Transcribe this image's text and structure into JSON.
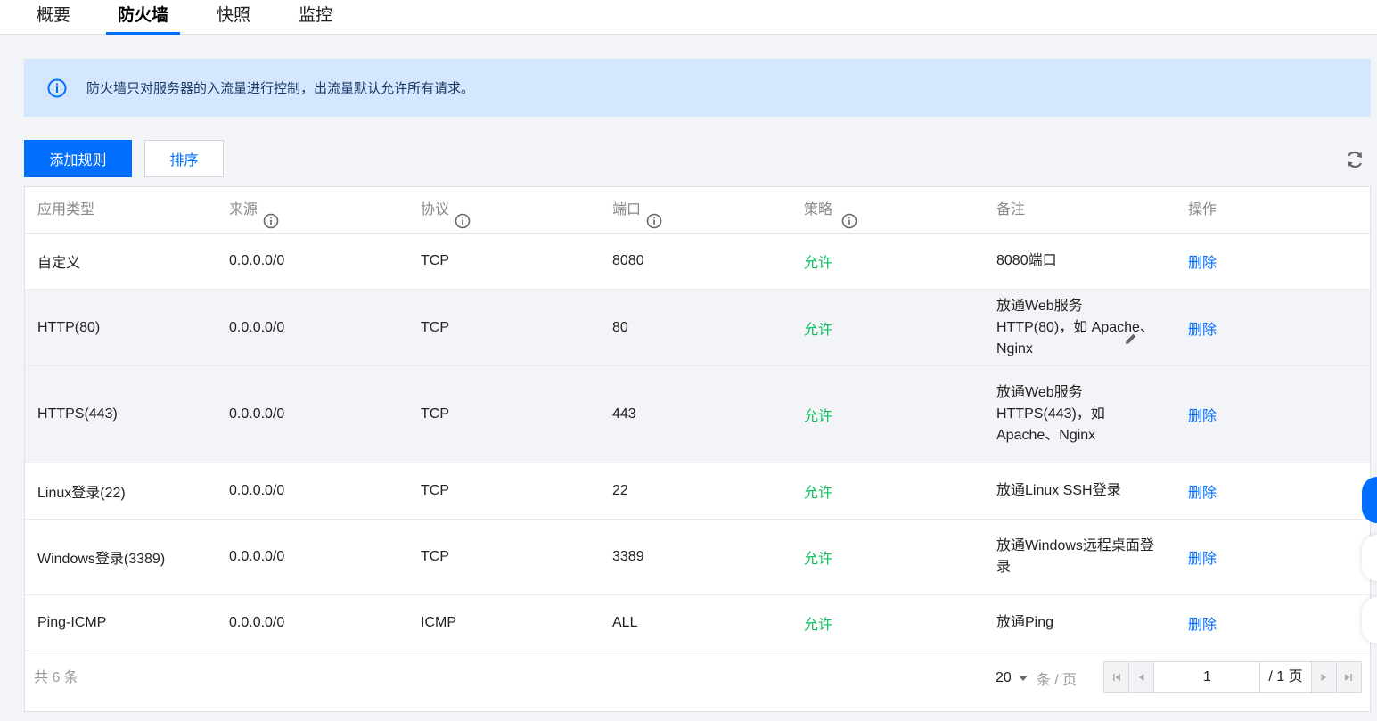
{
  "tabs": [
    {
      "label": "概要"
    },
    {
      "label": "防火墙",
      "active": true
    },
    {
      "label": "快照"
    },
    {
      "label": "监控"
    }
  ],
  "notice": {
    "icon": "info-icon",
    "text": "防火墙只对服务器的入流量进行控制，出流量默认允许所有请求。"
  },
  "toolbar": {
    "add_label": "添加规则",
    "sort_label": "排序",
    "refresh_icon": "refresh-icon"
  },
  "table": {
    "headers": {
      "type": "应用类型",
      "source": "来源",
      "protocol": "协议",
      "port": "端口",
      "policy": "策略",
      "note": "备注",
      "action": "操作"
    },
    "rows": [
      {
        "type": "自定义",
        "source": "0.0.0.0/0",
        "protocol": "TCP",
        "port": "8080",
        "policy": "允许",
        "note": "8080端口",
        "action": "删除"
      },
      {
        "type": "HTTP(80)",
        "source": "0.0.0.0/0",
        "protocol": "TCP",
        "port": "80",
        "policy": "允许",
        "note": "放通Web服务HTTP(80)，如 Apache、Nginx",
        "action": "删除"
      },
      {
        "type": "HTTPS(443)",
        "source": "0.0.0.0/0",
        "protocol": "TCP",
        "port": "443",
        "policy": "允许",
        "note": "放通Web服务HTTPS(443)，如Apache、Nginx",
        "action": "删除"
      },
      {
        "type": "Linux登录(22)",
        "source": "0.0.0.0/0",
        "protocol": "TCP",
        "port": "22",
        "policy": "允许",
        "note": "放通Linux SSH登录",
        "action": "删除"
      },
      {
        "type": "Windows登录(3389)",
        "source": "0.0.0.0/0",
        "protocol": "TCP",
        "port": "3389",
        "policy": "允许",
        "note": "放通Windows远程桌面登录",
        "action": "删除"
      },
      {
        "type": "Ping-ICMP",
        "source": "0.0.0.0/0",
        "protocol": "ICMP",
        "port": "ALL",
        "policy": "允许",
        "note": "放通Ping",
        "action": "删除"
      }
    ]
  },
  "footer": {
    "total": "共 6 条",
    "page_size": "20",
    "page_size_unit": "条 / 页",
    "current_page": "1",
    "total_pages": "/ 1 页"
  },
  "colors": {
    "primary": "#006eff",
    "allow": "#0abf5b",
    "notice_bg": "#d5e7ff"
  }
}
